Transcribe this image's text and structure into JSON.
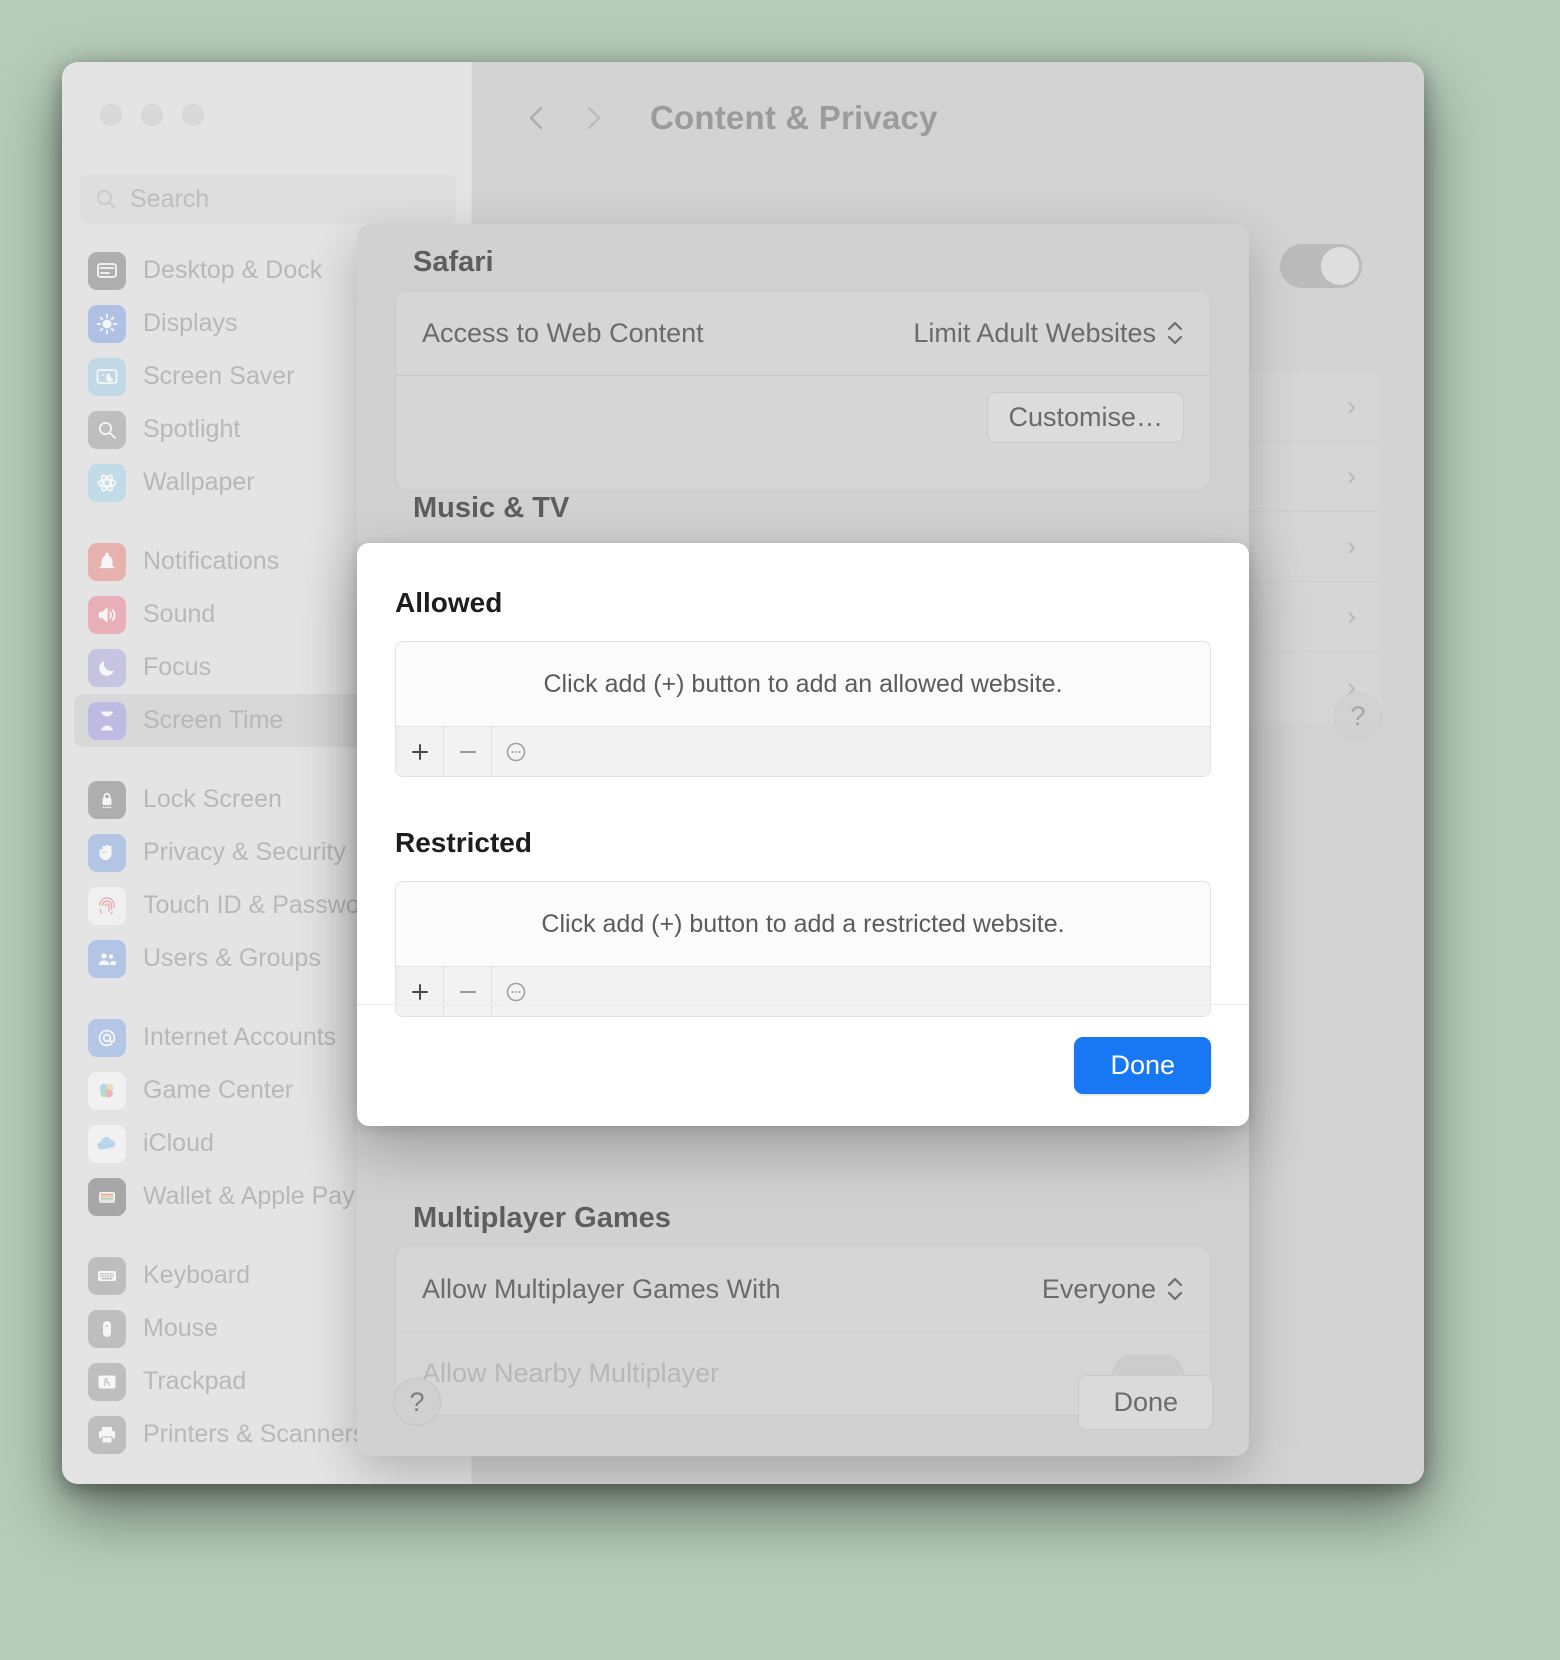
{
  "window": {
    "traffic_lights": [
      "close",
      "minimise",
      "zoom"
    ]
  },
  "sidebar": {
    "search": {
      "placeholder": "Search",
      "icon": "search-icon"
    },
    "groups": [
      {
        "items": [
          {
            "label": "Desktop & Dock",
            "icon": "desktop-dock-icon",
            "selected": false
          },
          {
            "label": "Displays",
            "icon": "displays-icon",
            "selected": false
          },
          {
            "label": "Screen Saver",
            "icon": "screen-saver-icon",
            "selected": false
          },
          {
            "label": "Spotlight",
            "icon": "spotlight-icon",
            "selected": false
          },
          {
            "label": "Wallpaper",
            "icon": "wallpaper-icon",
            "selected": false
          }
        ]
      },
      {
        "items": [
          {
            "label": "Notifications",
            "icon": "notifications-icon",
            "selected": false
          },
          {
            "label": "Sound",
            "icon": "sound-icon",
            "selected": false
          },
          {
            "label": "Focus",
            "icon": "focus-icon",
            "selected": false
          },
          {
            "label": "Screen Time",
            "icon": "screen-time-icon",
            "selected": true
          }
        ]
      },
      {
        "items": [
          {
            "label": "Lock Screen",
            "icon": "lock-screen-icon",
            "selected": false
          },
          {
            "label": "Privacy & Security",
            "icon": "privacy-security-icon",
            "selected": false
          },
          {
            "label": "Touch ID & Password",
            "icon": "touch-id-icon",
            "selected": false
          },
          {
            "label": "Users & Groups",
            "icon": "users-groups-icon",
            "selected": false
          }
        ]
      },
      {
        "items": [
          {
            "label": "Internet Accounts",
            "icon": "internet-accounts-icon",
            "selected": false
          },
          {
            "label": "Game Center",
            "icon": "game-center-icon",
            "selected": false
          },
          {
            "label": "iCloud",
            "icon": "icloud-icon",
            "selected": false
          },
          {
            "label": "Wallet & Apple Pay",
            "icon": "wallet-icon",
            "selected": false
          }
        ]
      },
      {
        "items": [
          {
            "label": "Keyboard",
            "icon": "keyboard-icon",
            "selected": false
          },
          {
            "label": "Mouse",
            "icon": "mouse-icon",
            "selected": false
          },
          {
            "label": "Trackpad",
            "icon": "trackpad-icon",
            "selected": false
          },
          {
            "label": "Printers & Scanners",
            "icon": "printers-icon",
            "selected": false
          }
        ]
      }
    ]
  },
  "toolbar": {
    "back_icon": "chevron-left-icon",
    "forward_icon": "chevron-right-icon",
    "title": "Content & Privacy"
  },
  "content_privacy_sheet": {
    "sections": [
      {
        "title": "Safari",
        "rows": [
          {
            "label": "Access to Web Content",
            "value": "Limit Adult Websites",
            "control": "popup-button"
          }
        ],
        "action_button": "Customise…"
      },
      {
        "title": "Music & TV",
        "rows": []
      },
      {
        "title": "Multiplayer Games",
        "rows": [
          {
            "label": "Allow Multiplayer Games With",
            "value": "Everyone",
            "control": "popup-button"
          },
          {
            "label": "Allow Nearby Multiplayer",
            "value": "",
            "control": "toggle"
          }
        ]
      }
    ],
    "footer": {
      "help_label": "?",
      "done_label": "Done"
    }
  },
  "websites_modal": {
    "allowed": {
      "title": "Allowed",
      "empty_message": "Click add (+) button to add an allowed website.",
      "toolbar": [
        {
          "name": "add-website-button",
          "glyph": "+"
        },
        {
          "name": "remove-website-button",
          "glyph": "−"
        },
        {
          "name": "more-options-button",
          "glyph": "⋯"
        }
      ]
    },
    "restricted": {
      "title": "Restricted",
      "empty_message": "Click add (+) button to add a restricted website.",
      "toolbar": [
        {
          "name": "add-website-button",
          "glyph": "+"
        },
        {
          "name": "remove-website-button",
          "glyph": "−"
        },
        {
          "name": "more-options-button",
          "glyph": "⋯"
        }
      ]
    },
    "done_label": "Done"
  },
  "colors": {
    "accent": "#1877f2",
    "window_bg": "#d3d3d3",
    "sidebar_bg": "#dfdfdf",
    "modal_bg": "#ffffff"
  }
}
